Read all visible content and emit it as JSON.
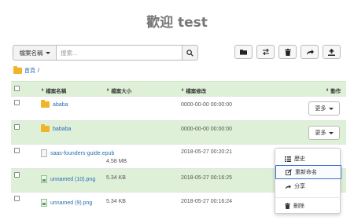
{
  "title": "歡迎 test",
  "search": {
    "select_label": "檔案名稱",
    "placeholder": "搜索..."
  },
  "toolbar": {
    "icons": [
      "folder-icon",
      "transfer-icon",
      "trash-icon",
      "share-icon",
      "upload-icon"
    ]
  },
  "breadcrumb": {
    "home": "首頁",
    "separator": "/"
  },
  "table": {
    "headers": {
      "name": "檔案名稱",
      "size": "檔案大小",
      "modified": "檔案修改",
      "actions": "動作",
      "sort_icon": "⬍"
    },
    "rows": [
      {
        "name": "ababa",
        "type": "folder",
        "size": "",
        "date": "0000-00-00 00:00:00",
        "action": "更多"
      },
      {
        "name": "bababa",
        "type": "folder",
        "size": "",
        "date": "0000-00-00 00:00:00",
        "action": "更多"
      },
      {
        "name": "saas-founders-guide.epub",
        "type": "doc",
        "size": "4.58 MB",
        "date": "2018-05-27 00:20:21",
        "action": ""
      },
      {
        "name": "unnamed (10).png",
        "type": "image",
        "size": "5.34 KB",
        "date": "2018-05-27 00:16:25",
        "action": ""
      },
      {
        "name": "unnamed (9).png",
        "type": "image",
        "size": "5.34 KB",
        "date": "2018-05-27 00:16:24",
        "action": ""
      }
    ]
  },
  "context_menu": {
    "items": [
      {
        "label": "歷史",
        "icon": "list-icon"
      },
      {
        "label": "重新命名",
        "icon": "edit-icon"
      },
      {
        "label": "分享",
        "icon": "share-icon"
      },
      {
        "label": "刪除",
        "icon": "trash-icon"
      }
    ]
  }
}
